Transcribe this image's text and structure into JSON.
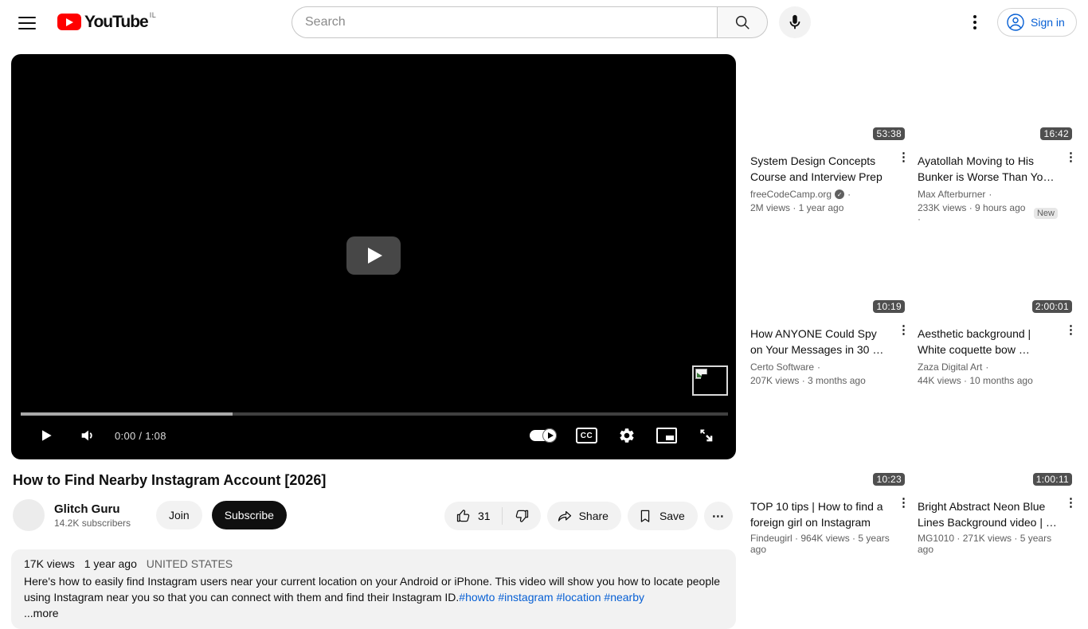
{
  "colors": {
    "accent_blue": "#065fd4",
    "brand_red": "#ff0000",
    "pill_gray": "#f2f2f2",
    "subscribe_black": "#0f0f0f"
  },
  "header": {
    "logo_text": "YouTube",
    "country_code": "IL",
    "search_placeholder": "Search",
    "signin_label": "Sign in"
  },
  "player": {
    "time_display": "0:00 / 1:08",
    "cc_label": "CC",
    "buffered_pct": 30,
    "played_pct": 0
  },
  "video": {
    "title": "How to Find Nearby Instagram Account [2026]",
    "channel_name": "Glitch Guru",
    "channel_subscribers": "14.2K subscribers",
    "join_label": "Join",
    "subscribe_label": "Subscribe",
    "like_count": "31",
    "share_label": "Share",
    "save_label": "Save",
    "more_label": "⋯"
  },
  "description": {
    "views": "17K views",
    "date": "1 year ago",
    "location": "UNITED STATES",
    "text": "Here's how to easily find Instagram users near your current location on your Android or iPhone. This video will show you how to locate people using Instagram near you so that you can connect with them and find their Instagram ID.",
    "hashtags": "#howto #instagram #location #nearby",
    "more_label": "...more"
  },
  "sidebar": {
    "videos": [
      {
        "duration": "53:38",
        "title": "System Design Concepts Course and Interview Prep",
        "channel": "freeCodeCamp.org",
        "sep": "·",
        "meta": "2M views · 1 year ago",
        "menu": "⋮"
      },
      {
        "duration": "16:42",
        "title": "Ayatollah Moving to His Bunker is Worse Than Yo…",
        "channel": "Max Afterburner",
        "sep": "·",
        "meta": "233K views · 9 hours ago ·",
        "badge": "New",
        "menu": "⋮"
      },
      {
        "duration": "10:19",
        "title": "How ANYONE Could Spy on Your Messages in 30 …",
        "channel": "Certo Software",
        "sep": "·",
        "meta": "207K views · 3 months ago",
        "menu": "⋮"
      },
      {
        "duration": "2:00:01",
        "title": "Aesthetic background | White coquette bow …",
        "channel": "Zaza Digital Art",
        "sep": "·",
        "meta": "44K views · 10 months ago",
        "menu": "⋮"
      },
      {
        "duration": "10:23",
        "title": "TOP 10 tips | How to find a foreign girl on Instagram",
        "meta": "Findeugirl · 964K views · 5 years ago",
        "menu": "⋮"
      },
      {
        "duration": "1:00:11",
        "title": "Bright Abstract Neon Blue Lines Background video | …",
        "meta": "MG1010 · 271K views · 5 years ago",
        "menu": "⋮"
      }
    ]
  }
}
